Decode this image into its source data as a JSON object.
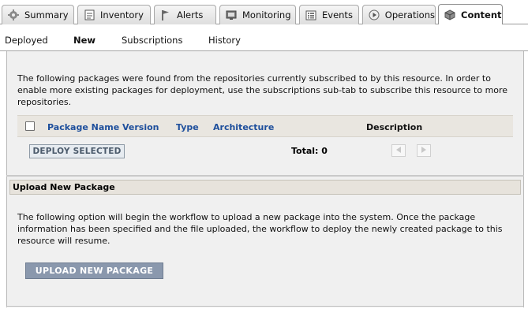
{
  "tabs": [
    {
      "label": "Summary",
      "icon": "gear-icon"
    },
    {
      "label": "Inventory",
      "icon": "inventory-icon"
    },
    {
      "label": "Alerts",
      "icon": "flag-icon"
    },
    {
      "label": "Monitoring",
      "icon": "monitor-icon"
    },
    {
      "label": "Events",
      "icon": "events-list-icon"
    },
    {
      "label": "Operations",
      "icon": "play-icon"
    },
    {
      "label": "Content",
      "icon": "package-icon",
      "active": true
    }
  ],
  "subtabs": [
    {
      "label": "Deployed"
    },
    {
      "label": "New",
      "active": true
    },
    {
      "label": "Subscriptions"
    },
    {
      "label": "History"
    }
  ],
  "new_packages": {
    "intro_text": "The following packages were found from the repositories currently subscribed to by this resource. In order to enable more existing packages for deployment, use the subscriptions sub-tab to subscribe this resource to more repositories.",
    "columns": [
      "Package Name",
      "Version",
      "Type",
      "Architecture",
      "Description"
    ],
    "rows": [],
    "deploy_button": "DEPLOY SELECTED",
    "total_label": "Total: 0"
  },
  "upload": {
    "section_title": "Upload New Package",
    "text": "The following option will begin the workflow to upload a new package into the system. Once the package information has been specified and the file uploaded, the workflow to deploy the newly created package to this resource will resume.",
    "button": "UPLOAD NEW PACKAGE"
  },
  "colors": {
    "link_blue": "#1e4f9c",
    "upload_button": "#8a98ad",
    "panel_background": "#f0f0f0"
  }
}
